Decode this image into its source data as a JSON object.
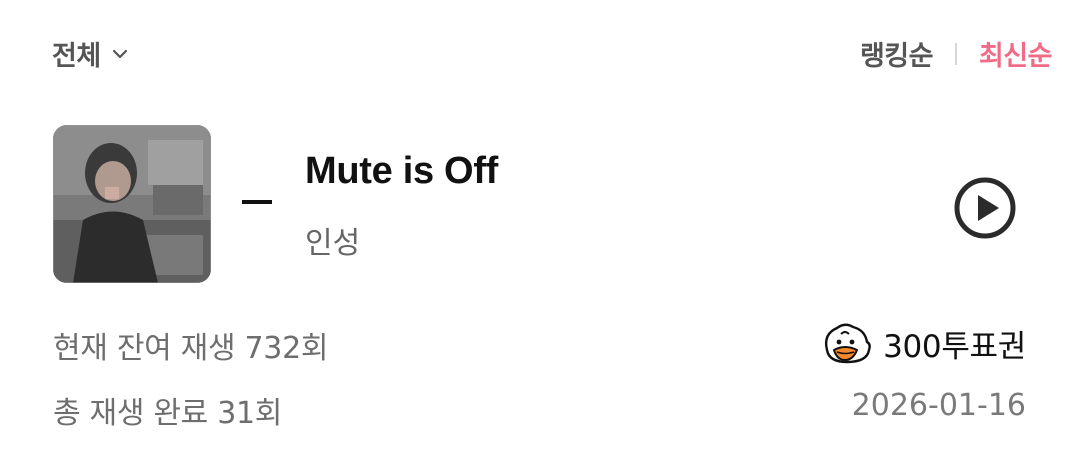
{
  "filter": {
    "label": "전체",
    "icon": "chevron-down-icon"
  },
  "sort": {
    "ranking_label": "랭킹순",
    "latest_label": "최신순",
    "active": "latest",
    "active_color": "#f26b86"
  },
  "song": {
    "prefix": "_",
    "title": "Mute is Off",
    "artist": "인성",
    "play_icon": "play-circle-icon"
  },
  "stats": {
    "remaining_plays": "현재 잔여 재생 732회",
    "completed_plays": "총 재생 완료 31회"
  },
  "vote": {
    "icon": "duck-icon",
    "label": "300투표권"
  },
  "date": "2026-01-16"
}
